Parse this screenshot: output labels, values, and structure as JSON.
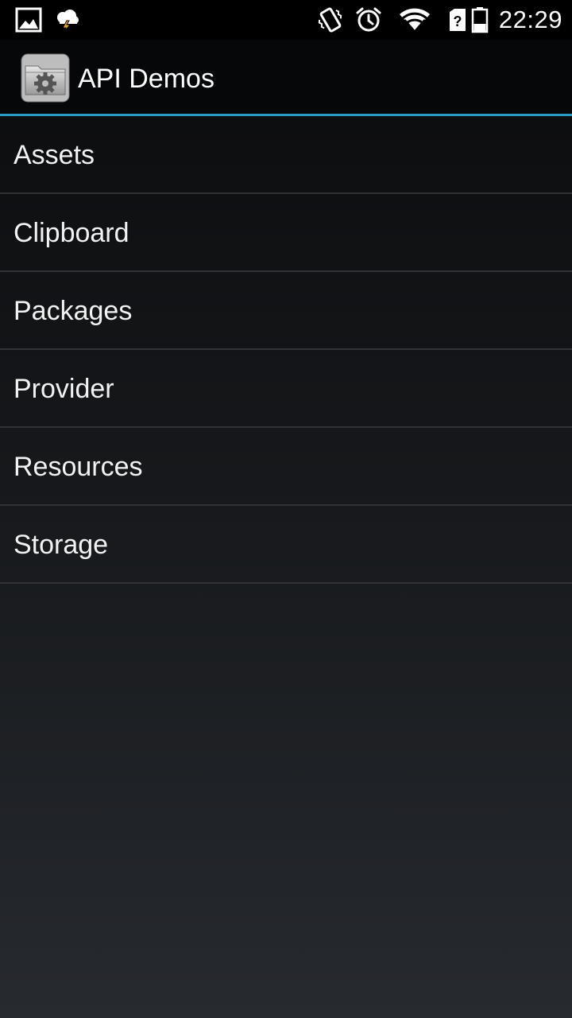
{
  "status_bar": {
    "time": "22:29",
    "left_icons": [
      "gallery-icon",
      "weather-storm-icon"
    ],
    "right_icons": [
      "vibrate-icon",
      "alarm-icon",
      "wifi-icon",
      "no-sim-icon",
      "battery-icon"
    ]
  },
  "action_bar": {
    "title": "API Demos",
    "accent_color": "#33b5e5"
  },
  "list": {
    "items": [
      {
        "label": "Assets"
      },
      {
        "label": "Clipboard"
      },
      {
        "label": "Packages"
      },
      {
        "label": "Provider"
      },
      {
        "label": "Resources"
      },
      {
        "label": "Storage"
      }
    ]
  }
}
